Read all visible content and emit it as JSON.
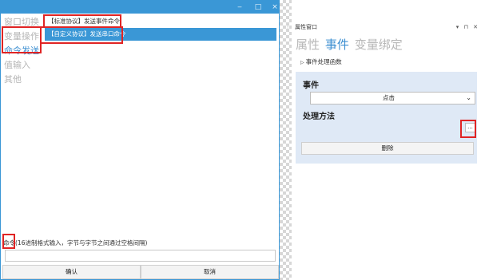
{
  "dialog": {
    "window_controls": {
      "minimize": "‒",
      "maximize": "□",
      "close": "×"
    },
    "nav": [
      {
        "label": "窗口切换",
        "active": false
      },
      {
        "label": "变量操作",
        "active": false
      },
      {
        "label": "命令发送",
        "active": true
      },
      {
        "label": "值输入",
        "active": false
      },
      {
        "label": "其他",
        "active": false
      }
    ],
    "commands": [
      {
        "label": "【标准协议】发送事件命令",
        "selected": false
      },
      {
        "label": "【自定义协议】发送串口命令",
        "selected": true
      }
    ],
    "command_hint": "命令(16进制格式输入，字节与字节之间通过空格间隔)",
    "command_value": "",
    "confirm_label": "确认",
    "cancel_label": "取消"
  },
  "panel": {
    "title": "属性窗口",
    "tools": "▾ ⊓ ✕",
    "pin": "⁝",
    "tabs": [
      {
        "label": "属性",
        "active": false
      },
      {
        "label": "事件",
        "active": true
      },
      {
        "label": "变量绑定",
        "active": false
      }
    ],
    "section_title": "事件处理函数",
    "event_label": "事件",
    "event_value": "点击",
    "handler_label": "处理方法",
    "dots_label": "...",
    "delete_label": "删除"
  },
  "colors": {
    "accent": "#3a97d6",
    "annotation": "#e02424",
    "event_box": "#dfe9f6"
  }
}
